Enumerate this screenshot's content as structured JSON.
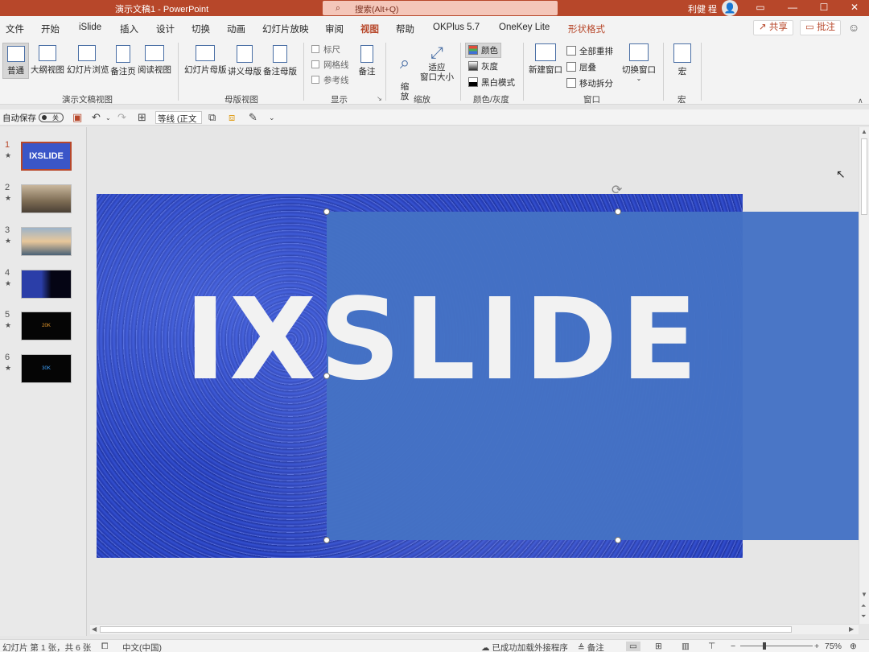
{
  "window": {
    "title": "演示文稿1 - PowerPoint",
    "search_placeholder": "搜索(Alt+Q)",
    "user": "利健 程",
    "avatar_glyph": "👤"
  },
  "tabs": [
    "文件",
    "开始",
    "iSlide",
    "插入",
    "设计",
    "切换",
    "动画",
    "幻灯片放映",
    "审阅",
    "视图",
    "帮助",
    "OKPlus 5.7",
    "OneKey Lite",
    "形状格式"
  ],
  "active_tab": "视图",
  "actions": {
    "share": "共享",
    "comment": "批注"
  },
  "ribbon": {
    "presentation_views": {
      "label": "演示文稿视图",
      "buttons": [
        "普通",
        "大纲视图",
        "幻灯片浏览",
        "备注页",
        "阅读视图"
      ]
    },
    "master_views": {
      "label": "母版视图",
      "buttons": [
        "幻灯片母版",
        "讲义母版",
        "备注母版"
      ]
    },
    "show": {
      "label": "显示",
      "checks": [
        "标尺",
        "网格线",
        "参考线"
      ],
      "notes": "备注"
    },
    "zoom": {
      "label": "缩放",
      "zoom_btn": "缩\n放",
      "fit_line1": "适应",
      "fit_line2": "窗口大小"
    },
    "color": {
      "label": "颜色/灰度",
      "items": [
        "颜色",
        "灰度",
        "黑白模式"
      ]
    },
    "window": {
      "label": "窗口",
      "new_window": "新建窗口",
      "items": [
        "全部重排",
        "层叠",
        "移动拆分"
      ],
      "switch": "切换窗口"
    },
    "macros": {
      "label": "宏",
      "button": "宏"
    }
  },
  "qat": {
    "autosave_label": "自动保存",
    "autosave_state": "关",
    "font": "等线 (正文"
  },
  "slides": [
    {
      "num": "1",
      "star": "★",
      "caption": "IXSLIDE",
      "current": true
    },
    {
      "num": "2",
      "star": "★",
      "caption": "",
      "current": false
    },
    {
      "num": "3",
      "star": "★",
      "caption": "",
      "current": false
    },
    {
      "num": "4",
      "star": "★",
      "caption": "",
      "current": false
    },
    {
      "num": "5",
      "star": "★",
      "caption": "20K",
      "current": false
    },
    {
      "num": "6",
      "star": "★",
      "caption": "30K",
      "current": false
    }
  ],
  "slide_main": {
    "text": "IXSLIDE",
    "shape_color": "#4472c4"
  },
  "status": {
    "slide_info": "幻灯片 第 1 张，共 6 张",
    "language": "中文(中国)",
    "addin": "已成功加载外接程序",
    "notes": "备注",
    "zoom": "75%"
  },
  "colors": {
    "accent": "#b7472a"
  }
}
